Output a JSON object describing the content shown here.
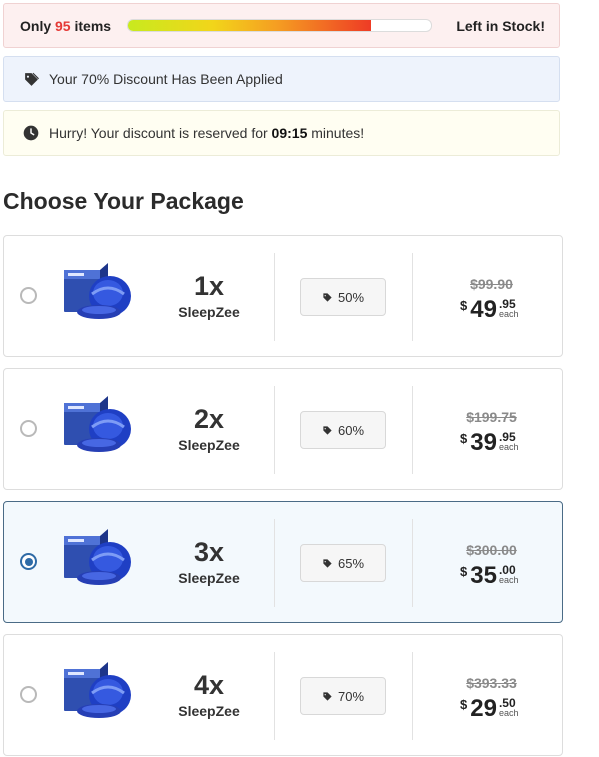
{
  "stock": {
    "prefix": "Only ",
    "count": "95",
    "suffix": " items",
    "right_label": "Left in Stock!",
    "progress_percent": 80,
    "gradient_colors": [
      "#c8ea1e",
      "#f2d51a",
      "#f59c22",
      "#ee3b25"
    ]
  },
  "discount": {
    "icon": "tag-icon",
    "text": "Your 70% Discount Has Been Applied"
  },
  "timer": {
    "icon": "clock-icon",
    "before": "Hurry! Your discount is reserved for ",
    "time": "09:15",
    "after": " minutes!"
  },
  "section_title": "Choose Your Package",
  "packages": [
    {
      "qty": "1x",
      "name": "SleepZee",
      "discount": "50%",
      "old_price": "$99.90",
      "currency": "$",
      "price_int": "49",
      "price_cents": ".95",
      "unit": "each",
      "selected": false
    },
    {
      "qty": "2x",
      "name": "SleepZee",
      "discount": "60%",
      "old_price": "$199.75",
      "currency": "$",
      "price_int": "39",
      "price_cents": ".95",
      "unit": "each",
      "selected": false
    },
    {
      "qty": "3x",
      "name": "SleepZee",
      "discount": "65%",
      "old_price": "$300.00",
      "currency": "$",
      "price_int": "35",
      "price_cents": ".00",
      "unit": "each",
      "selected": true
    },
    {
      "qty": "4x",
      "name": "SleepZee",
      "discount": "70%",
      "old_price": "$393.33",
      "currency": "$",
      "price_int": "29",
      "price_cents": ".50",
      "unit": "each",
      "selected": false
    }
  ],
  "colors": {
    "accent": "#2e6ba6",
    "selected_bg": "#f3f9fd",
    "stock_count": "#e53935"
  },
  "product_image_icon": "sleepzee-product-box-icon"
}
